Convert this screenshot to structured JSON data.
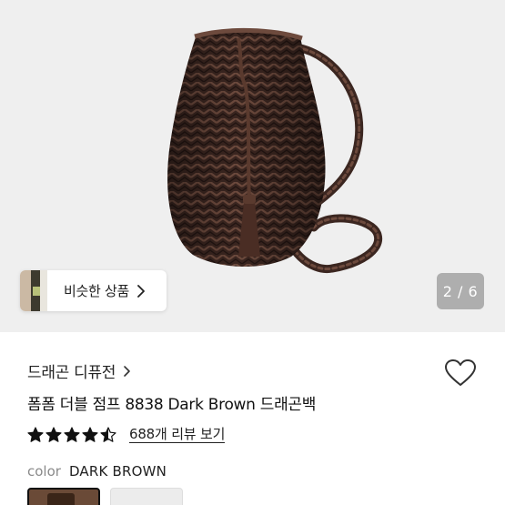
{
  "gallery": {
    "current": 2,
    "total": 6,
    "counter_text": "2 / 6",
    "similar_products_label": "비슷한 상품"
  },
  "product": {
    "brand": "드래곤 디퓨전",
    "title": "폼폼 더블 점프 8838 Dark Brown 드래곤백",
    "rating": 4.5,
    "rating_max": 5,
    "reviews_link": "688개 리뷰 보기"
  },
  "color": {
    "label": "color",
    "value": "DARK BROWN",
    "swatches": [
      "dark-brown",
      "light-grey"
    ]
  },
  "icons": {
    "heart": "heart-outline-icon",
    "chevron": "chevron-right-icon",
    "star": "star-icon"
  },
  "colors": {
    "hero_bg": "#efefef",
    "bag": "#3b2620",
    "text": "#111111",
    "muted": "#8a8a8a"
  }
}
